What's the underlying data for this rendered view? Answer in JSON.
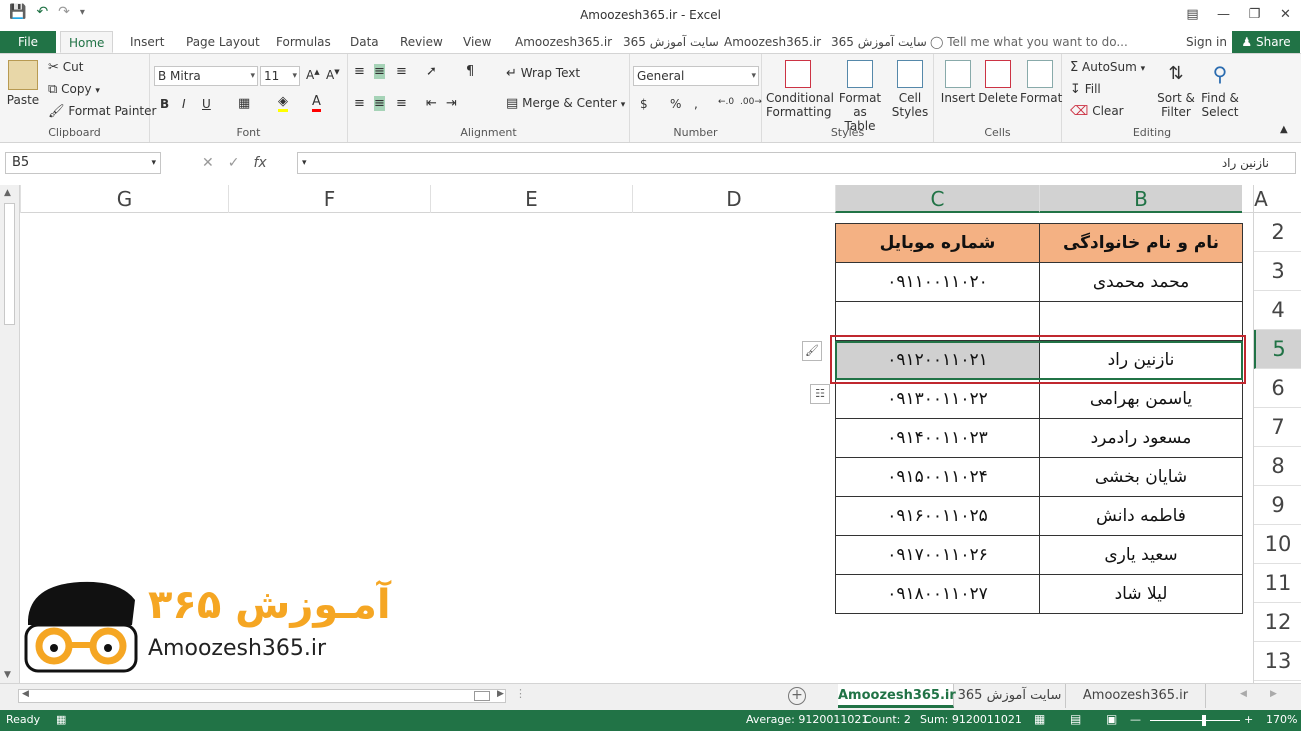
{
  "title": "Amoozesh365.ir - Excel",
  "tabs": {
    "file": "File",
    "home": "Home",
    "insert": "Insert",
    "page_layout": "Page Layout",
    "formulas": "Formulas",
    "data": "Data",
    "review": "Review",
    "view": "View",
    "custom1": "Amoozesh365.ir",
    "custom2": "سایت آموزش 365",
    "custom3": "Amoozesh365.ir",
    "custom4": "سایت آموزش 365",
    "tellme": "Tell me what you want to do...",
    "signin": "Sign in",
    "share": "Share"
  },
  "ribbon": {
    "clipboard": {
      "paste": "Paste",
      "cut": "Cut",
      "copy": "Copy",
      "format_painter": "Format Painter",
      "label": "Clipboard"
    },
    "font": {
      "name": "B Mitra",
      "size": "11",
      "label": "Font",
      "bold": "B",
      "italic": "I",
      "underline": "U"
    },
    "alignment": {
      "wrap": "Wrap Text",
      "merge": "Merge & Center",
      "label": "Alignment"
    },
    "number": {
      "format": "General",
      "label": "Number",
      "currency": "$",
      "percent": "%",
      "comma": ","
    },
    "styles": {
      "conditional": "Conditional",
      "conditional2": "Formatting",
      "format_table": "Format as",
      "format_table2": "Table",
      "cell_styles": "Cell",
      "cell_styles2": "Styles",
      "label": "Styles"
    },
    "cells": {
      "insert": "Insert",
      "delete": "Delete",
      "format": "Format",
      "label": "Cells"
    },
    "editing": {
      "autosum": "AutoSum",
      "fill": "Fill",
      "clear": "Clear",
      "sort": "Sort &",
      "sort2": "Filter",
      "find": "Find &",
      "find2": "Select",
      "label": "Editing"
    }
  },
  "formula_bar": {
    "name_box": "B5",
    "value": "نازنین راد"
  },
  "columns": [
    "G",
    "F",
    "E",
    "D",
    "C",
    "B",
    "A"
  ],
  "rows": [
    "2",
    "3",
    "4",
    "5",
    "6",
    "7",
    "8",
    "9",
    "10",
    "11",
    "12",
    "13"
  ],
  "table": {
    "header_b": "نام و نام خانوادگی",
    "header_c": "شماره موبایل",
    "rows": [
      {
        "b": "محمد محمدی",
        "c": "۰۹۱۱۰۰۱۱۰۲۰"
      },
      {
        "b": "",
        "c": ""
      },
      {
        "b": "نازنین راد",
        "c": "۰۹۱۲۰۰۱۱۰۲۱"
      },
      {
        "b": "یاسمن بهرامی",
        "c": "۰۹۱۳۰۰۱۱۰۲۲"
      },
      {
        "b": "مسعود رادمرد",
        "c": "۰۹۱۴۰۰۱۱۰۲۳"
      },
      {
        "b": "شایان بخشی",
        "c": "۰۹۱۵۰۰۱۱۰۲۴"
      },
      {
        "b": "فاطمه دانش",
        "c": "۰۹۱۶۰۰۱۱۰۲۵"
      },
      {
        "b": "سعید یاری",
        "c": "۰۹۱۷۰۰۱۱۰۲۶"
      },
      {
        "b": "لیلا شاد",
        "c": "۰۹۱۸۰۰۱۱۰۲۷"
      }
    ]
  },
  "logo": {
    "fa": "آمـوزش ۳۶۵",
    "en": "Amoozesh365.ir"
  },
  "sheets": [
    "Amoozesh365.ir",
    "سایت آموزش 365",
    "Amoozesh365.ir"
  ],
  "status": {
    "ready": "Ready",
    "average": "Average: 9120011021",
    "count": "Count: 2",
    "sum": "Sum: 9120011021",
    "zoom": "170%"
  },
  "colors": {
    "excel_green": "#217346",
    "header_fill": "#f4b183",
    "highlight_border": "#c0282f"
  }
}
